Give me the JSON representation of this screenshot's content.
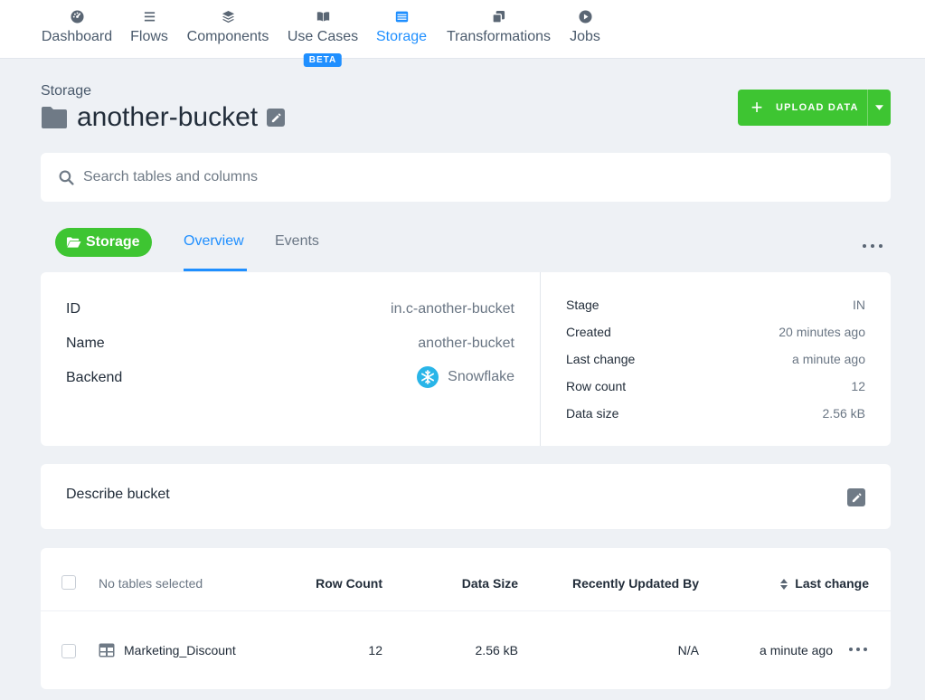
{
  "nav": {
    "items": [
      {
        "label": "Dashboard",
        "icon": "gauge-icon"
      },
      {
        "label": "Flows",
        "icon": "list-icon"
      },
      {
        "label": "Components",
        "icon": "layers-icon"
      },
      {
        "label": "Use Cases",
        "icon": "book-icon",
        "badge": "BETA"
      },
      {
        "label": "Storage",
        "icon": "database-icon",
        "active": true
      },
      {
        "label": "Transformations",
        "icon": "copy-icon"
      },
      {
        "label": "Jobs",
        "icon": "play-circle-icon"
      }
    ]
  },
  "header": {
    "breadcrumb": "Storage",
    "title": "another-bucket",
    "upload_label": "UPLOAD DATA"
  },
  "search": {
    "placeholder": "Search tables and columns"
  },
  "tabs": {
    "storage_pill": "Storage",
    "overview": "Overview",
    "events": "Events"
  },
  "overview": {
    "left": [
      {
        "label": "ID",
        "value": "in.c-another-bucket"
      },
      {
        "label": "Name",
        "value": "another-bucket"
      },
      {
        "label": "Backend",
        "value": "Snowflake"
      }
    ],
    "right": [
      {
        "label": "Stage",
        "value": "IN"
      },
      {
        "label": "Created",
        "value": "20 minutes ago"
      },
      {
        "label": "Last change",
        "value": "a minute ago"
      },
      {
        "label": "Row count",
        "value": "12"
      },
      {
        "label": "Data size",
        "value": "2.56 kB"
      }
    ]
  },
  "describe": {
    "label": "Describe bucket"
  },
  "table": {
    "headers": {
      "selection": "No tables selected",
      "row_count": "Row Count",
      "data_size": "Data Size",
      "updated_by": "Recently Updated By",
      "last_change": "Last change"
    },
    "rows": [
      {
        "name": "Marketing_Discount",
        "row_count": "12",
        "data_size": "2.56 kB",
        "updated_by": "N/A",
        "last_change": "a minute ago"
      }
    ]
  },
  "colors": {
    "accent": "#1f8fff",
    "success": "#3ec532",
    "text": "#222d3a",
    "muted": "#6a7684",
    "background": "#eef1f5"
  }
}
